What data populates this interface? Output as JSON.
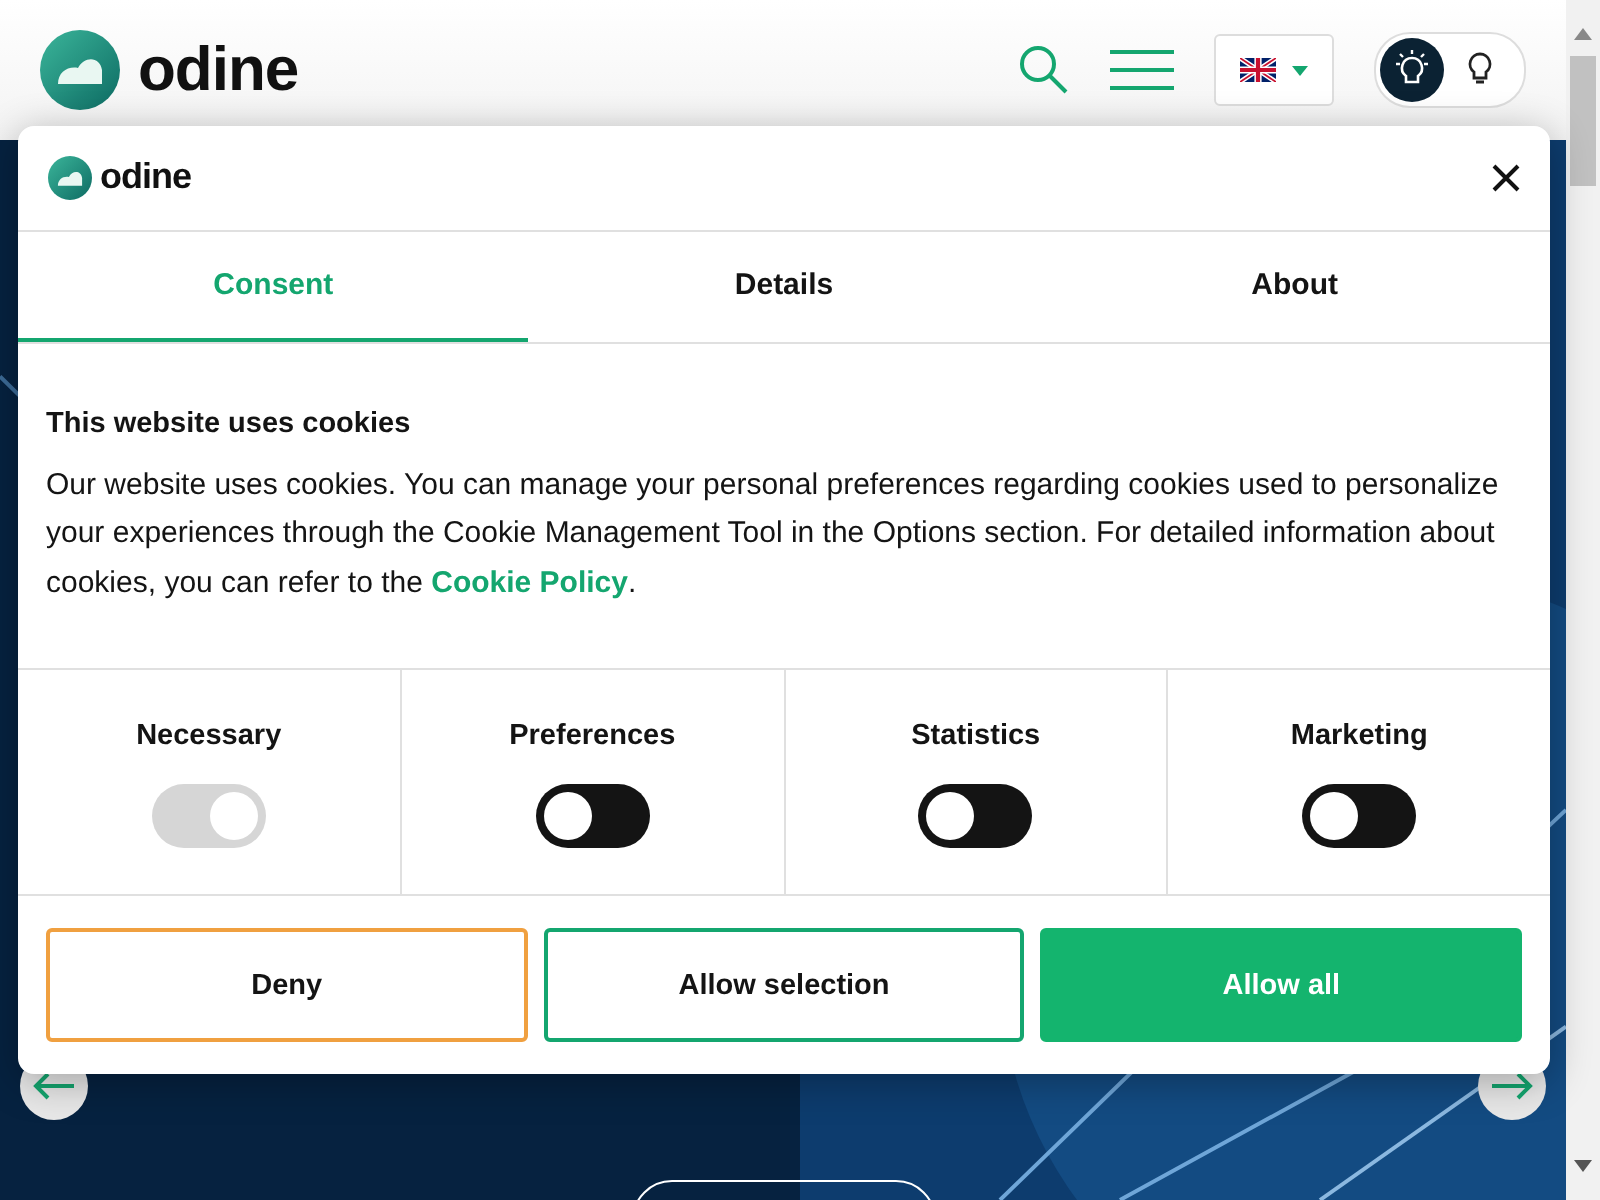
{
  "header": {
    "brand": "odine",
    "theme_options": [
      {
        "selected": true
      },
      {
        "selected": false
      }
    ]
  },
  "cookie_dialog": {
    "brand": "odine",
    "tabs": [
      {
        "label": "Consent",
        "selected": true
      },
      {
        "label": "Details",
        "selected": false
      },
      {
        "label": "About",
        "selected": false
      }
    ],
    "heading": "This website uses cookies",
    "body": "Our website uses cookies. You can manage your personal preferences regarding cookies used to personalize your experiences through the Cookie Management Tool in the Options section. For detailed information about cookies, you can refer to the ",
    "link": "Cookie Policy",
    "body_end": ".",
    "categories": [
      {
        "label": "Necessary",
        "checked": true,
        "disabled": true
      },
      {
        "label": "Preferences",
        "checked": false,
        "disabled": false
      },
      {
        "label": "Statistics",
        "checked": false,
        "disabled": false
      },
      {
        "label": "Marketing",
        "checked": false,
        "disabled": false
      }
    ],
    "buttons": [
      {
        "label": "Deny",
        "kind": "deny"
      },
      {
        "label": "Allow selection",
        "kind": "selection"
      },
      {
        "label": "Allow all",
        "kind": "all"
      }
    ]
  }
}
